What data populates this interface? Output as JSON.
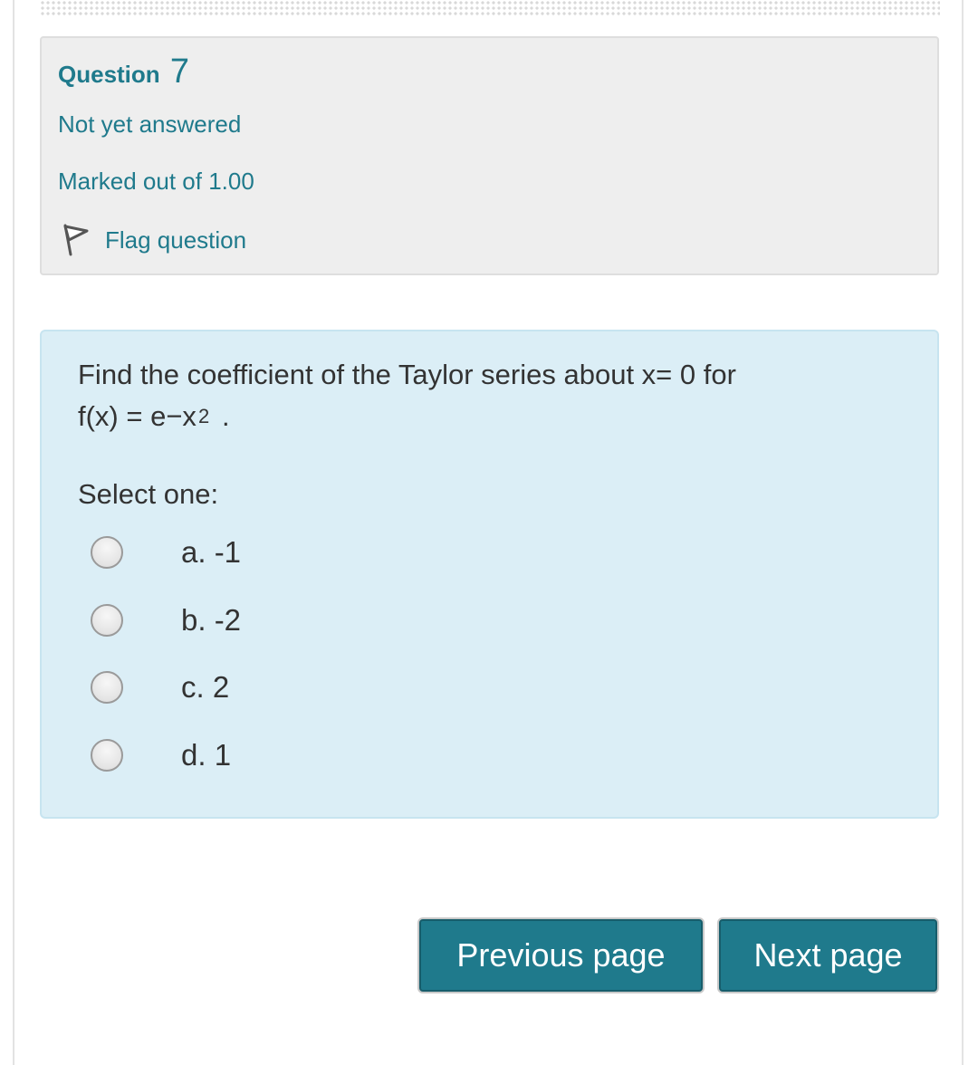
{
  "question_info": {
    "label": "Question",
    "number": "7",
    "state": "Not yet answered",
    "grade": "Marked out of 1.00",
    "flag_label": "Flag question"
  },
  "question": {
    "text_line1": "Find the coefficient of the Taylor series about x= 0 for",
    "text_line2": "f(x) = e−x",
    "exponent": "2",
    "trailing": ".",
    "prompt": "Select one:",
    "answers": [
      {
        "label": "a. -1",
        "selected": false
      },
      {
        "label": "b. -2",
        "selected": false
      },
      {
        "label": "c. 2",
        "selected": false
      },
      {
        "label": "d. 1",
        "selected": false
      }
    ]
  },
  "navigation": {
    "previous_label": "Previous page",
    "next_label": "Next page"
  },
  "colors": {
    "link": "#1f7a8c",
    "button": "#1f7a8c",
    "info_bg": "#eeeeee",
    "content_bg": "#dbeef6"
  }
}
